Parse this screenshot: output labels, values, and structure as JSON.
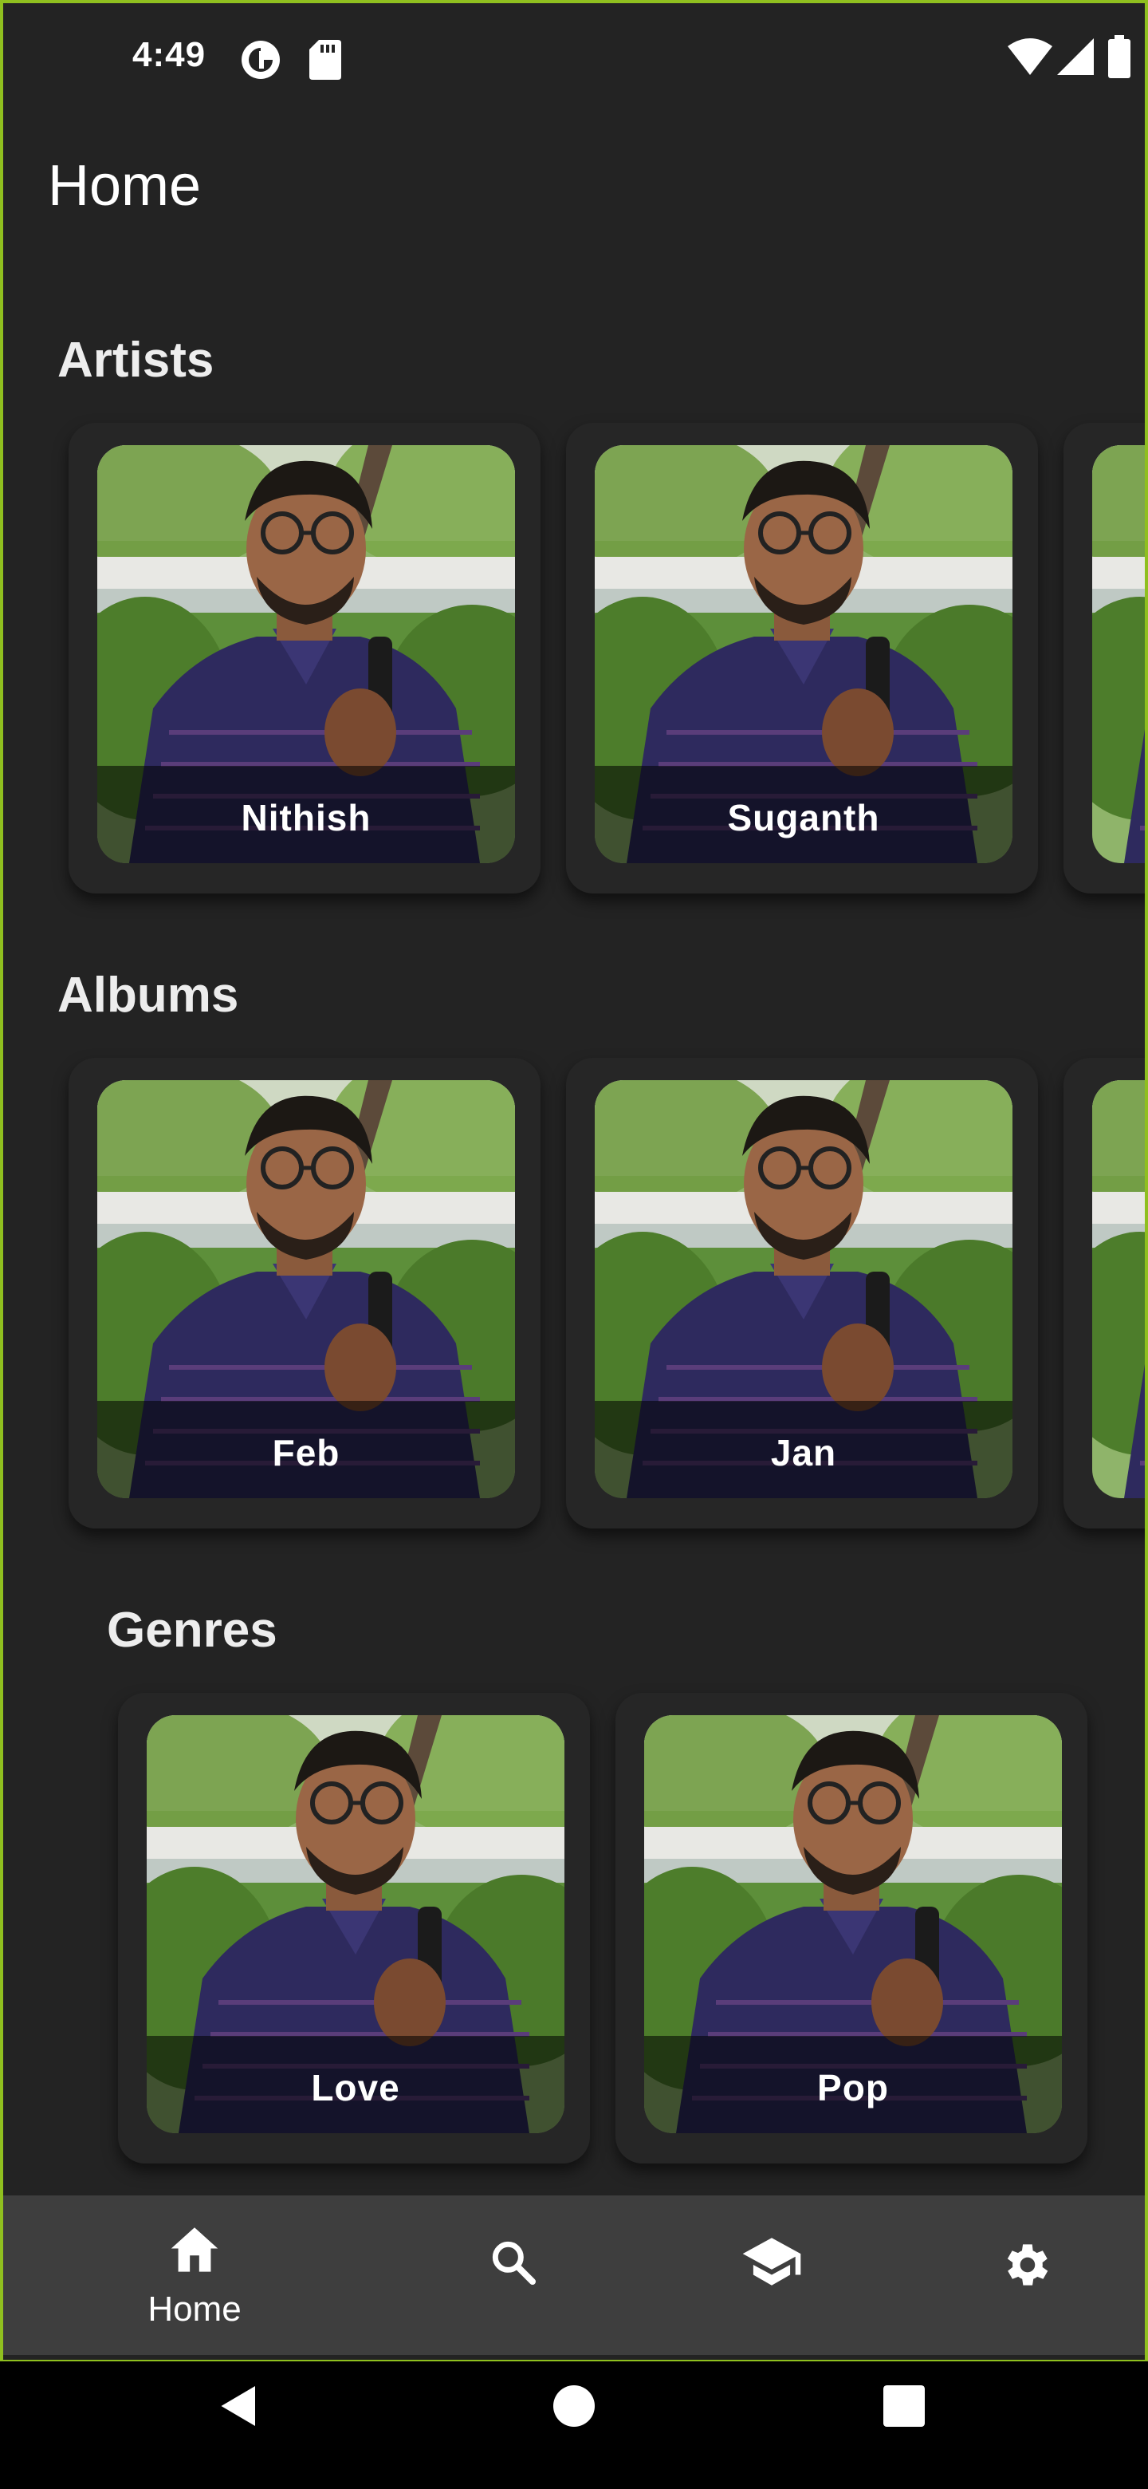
{
  "status_bar": {
    "time": "4:49",
    "left_icons": [
      "data-saver-icon",
      "sd-card-icon"
    ],
    "right_icons": [
      "wifi-icon",
      "signal-icon",
      "battery-icon"
    ]
  },
  "app_bar": {
    "title": "Home"
  },
  "sections": [
    {
      "title": "Artists",
      "items": [
        {
          "label": "Nithish"
        },
        {
          "label": "Suganth"
        },
        {
          "label": ""
        }
      ]
    },
    {
      "title": "Albums",
      "items": [
        {
          "label": "Feb"
        },
        {
          "label": "Jan"
        },
        {
          "label": ""
        }
      ]
    },
    {
      "title": "Genres",
      "items": [
        {
          "label": "Love"
        },
        {
          "label": "Pop"
        }
      ]
    }
  ],
  "bottom_nav": [
    {
      "icon": "home-icon",
      "label": "Home",
      "selected": true
    },
    {
      "icon": "search-icon",
      "label": ""
    },
    {
      "icon": "school-icon",
      "label": ""
    },
    {
      "icon": "settings-icon",
      "label": ""
    }
  ],
  "system_nav": [
    "back-icon",
    "home-circle-icon",
    "recents-icon"
  ]
}
